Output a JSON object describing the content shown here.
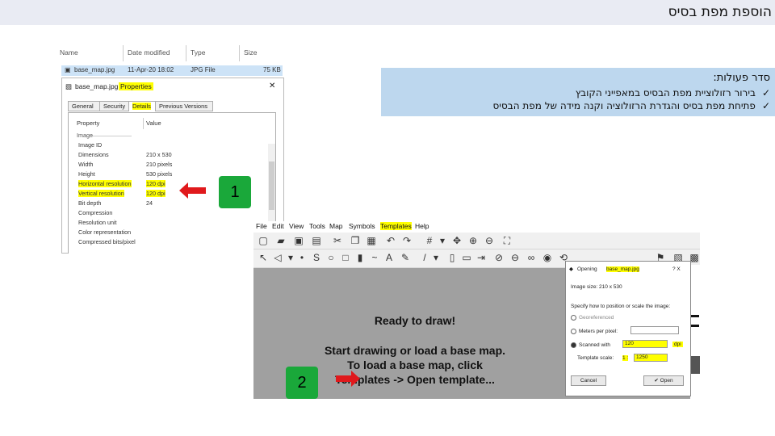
{
  "slide": {
    "title": "הוספת מפת בסיס"
  },
  "steps": {
    "header": "סדר פעולות:",
    "items": [
      {
        "check": "✓",
        "text": "בירור רזולוציית מפת הבסיס במאפייני הקובץ"
      },
      {
        "check": "✓",
        "text": "פתיחת מפת בסיס והגדרת הרזולוציה וקנה מידה של מפת הבסיס"
      }
    ]
  },
  "explorer": {
    "columns": [
      "Name",
      "Date modified",
      "Type",
      "Size"
    ],
    "file": {
      "name": "base_map.jpg",
      "date": "11-Apr-20 18:02",
      "type": "JPG File",
      "size": "75 KB"
    }
  },
  "properties": {
    "title_file": "base_map.jpg",
    "title_word": "Properties",
    "close": "✕",
    "tabs": [
      "General",
      "Security",
      "Details",
      "Previous Versions"
    ],
    "col_property": "Property",
    "col_value": "Value",
    "section": "Image",
    "rows": [
      {
        "name": "Image ID",
        "value": ""
      },
      {
        "name": "Dimensions",
        "value": "210 x 530"
      },
      {
        "name": "Width",
        "value": "210 pixels"
      },
      {
        "name": "Height",
        "value": "530 pixels"
      },
      {
        "name": "Horizontal resolution",
        "value": "120 dpi"
      },
      {
        "name": "Vertical resolution",
        "value": "120 dpi"
      },
      {
        "name": "Bit depth",
        "value": "24"
      },
      {
        "name": "Compression",
        "value": ""
      },
      {
        "name": "Resolution unit",
        "value": ""
      },
      {
        "name": "Color representation",
        "value": ""
      },
      {
        "name": "Compressed bits/pixel",
        "value": ""
      }
    ]
  },
  "badges": {
    "one": "1",
    "two": "2"
  },
  "colors": {
    "badge": "#1aa83a",
    "arrow": "#e0191c",
    "highlight": "#ffff00",
    "steps_bg": "#bdd7ee",
    "title_bg": "#e9ebf3"
  },
  "ocad": {
    "menu": [
      "File",
      "Edit",
      "View",
      "Tools",
      "Map",
      "Symbols",
      "Templates",
      "Help"
    ],
    "canvas": {
      "ready": "Ready to draw!",
      "line1": "Start drawing or load a base map.",
      "line2": "To load a base map, click",
      "line3": "Templates -> Open template..."
    },
    "dialog": {
      "title_prefix": "Opening ",
      "title_file": "base_map.jpg",
      "help": "? X",
      "image_size": "Image size: 210 x 530",
      "prompt": "Specify how to position or scale the image:",
      "opt_georef": "Georeferenced",
      "opt_meters": "Meters per pixel:",
      "opt_scanned": "Scanned with",
      "scan_value": "120",
      "scan_unit": "dpi",
      "template_scale": "Template scale:",
      "scale_prefix": "1 :",
      "scale_value": "1250",
      "cancel": "Cancel",
      "open": "Open"
    }
  }
}
